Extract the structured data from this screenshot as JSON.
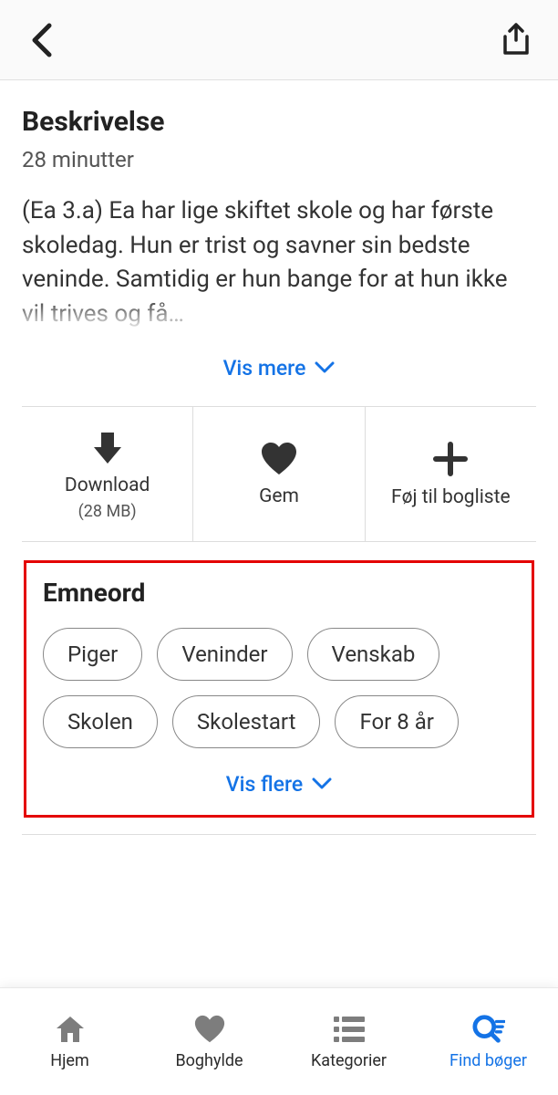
{
  "description": {
    "title": "Beskrivelse",
    "duration": "28 minutter",
    "text": "(Ea 3.a) Ea har lige skiftet skole og har første skoledag. Hun er trist og savner sin bedste veninde. Samtidig er hun bange for at hun ikke vil trives og få…",
    "show_more_label": "Vis mere"
  },
  "actions": {
    "download": {
      "label": "Download",
      "sub": "(28 MB)"
    },
    "save": {
      "label": "Gem"
    },
    "add": {
      "label": "Føj til bogliste"
    }
  },
  "tags": {
    "title": "Emneord",
    "items": [
      "Piger",
      "Veninder",
      "Venskab",
      "Skolen",
      "Skolestart",
      "For 8 år"
    ],
    "show_more_label": "Vis flere"
  },
  "nav": {
    "home": "Hjem",
    "shelf": "Boghylde",
    "categories": "Kategorier",
    "find": "Find bøger"
  }
}
